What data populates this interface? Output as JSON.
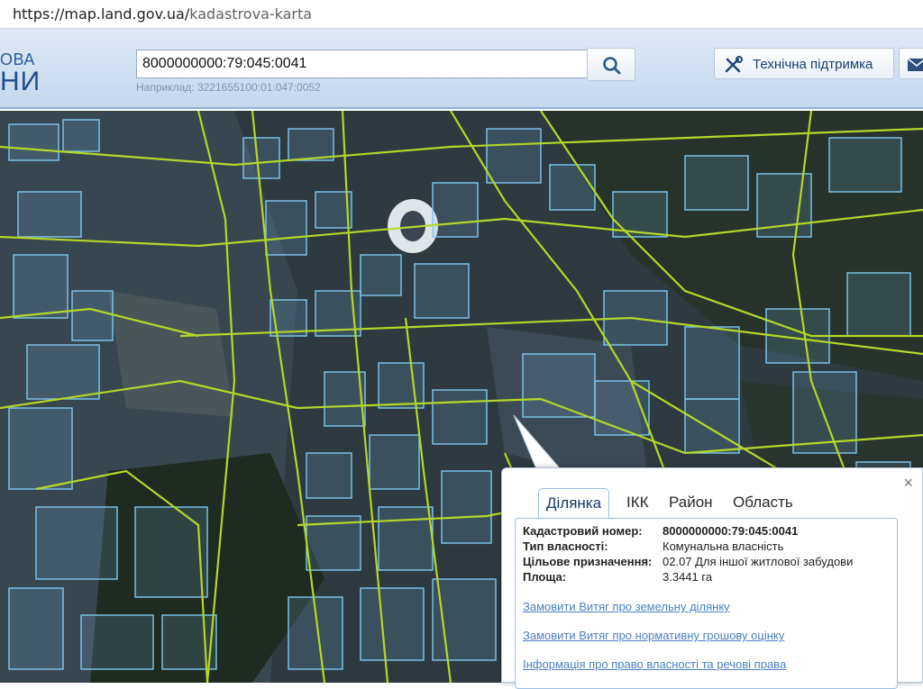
{
  "browser": {
    "url_host": "https://map.land.gov.ua/",
    "url_path": "kadastrova-karta"
  },
  "header": {
    "brand_line1": "ОВА",
    "brand_line2": "НИ",
    "search_value": "8000000000:79:045:0041",
    "search_icon": "search-icon",
    "hint": "Наприклад: 3221655100:01:047:0052",
    "support_label": "Технічна підтримка",
    "support_icon": "tools-icon",
    "mail_icon": "mail-icon"
  },
  "popup": {
    "close": "×",
    "tabs": [
      "Ділянка",
      "ІКК",
      "Район",
      "Область"
    ],
    "active_tab": "Ділянка",
    "fields": [
      {
        "label": "Кадастровий номер:",
        "value": "8000000000:79:045:0041"
      },
      {
        "label": "Тип власності:",
        "value": "Комунальна власність"
      },
      {
        "label": "Цільове призначення:",
        "value": "02.07 Для іншої житлової забудови"
      },
      {
        "label": "Площа:",
        "value": "3.3441 га"
      }
    ],
    "links": [
      "Замовити Витяг про земельну ділянку",
      "Замовити Витяг про нормативну грошову оцінку",
      "Інформація про право власності та речові права"
    ]
  },
  "colors": {
    "parcel_outline": "#7fc8f0",
    "road_outline": "#b5d628",
    "link": "#4a7fc1"
  }
}
